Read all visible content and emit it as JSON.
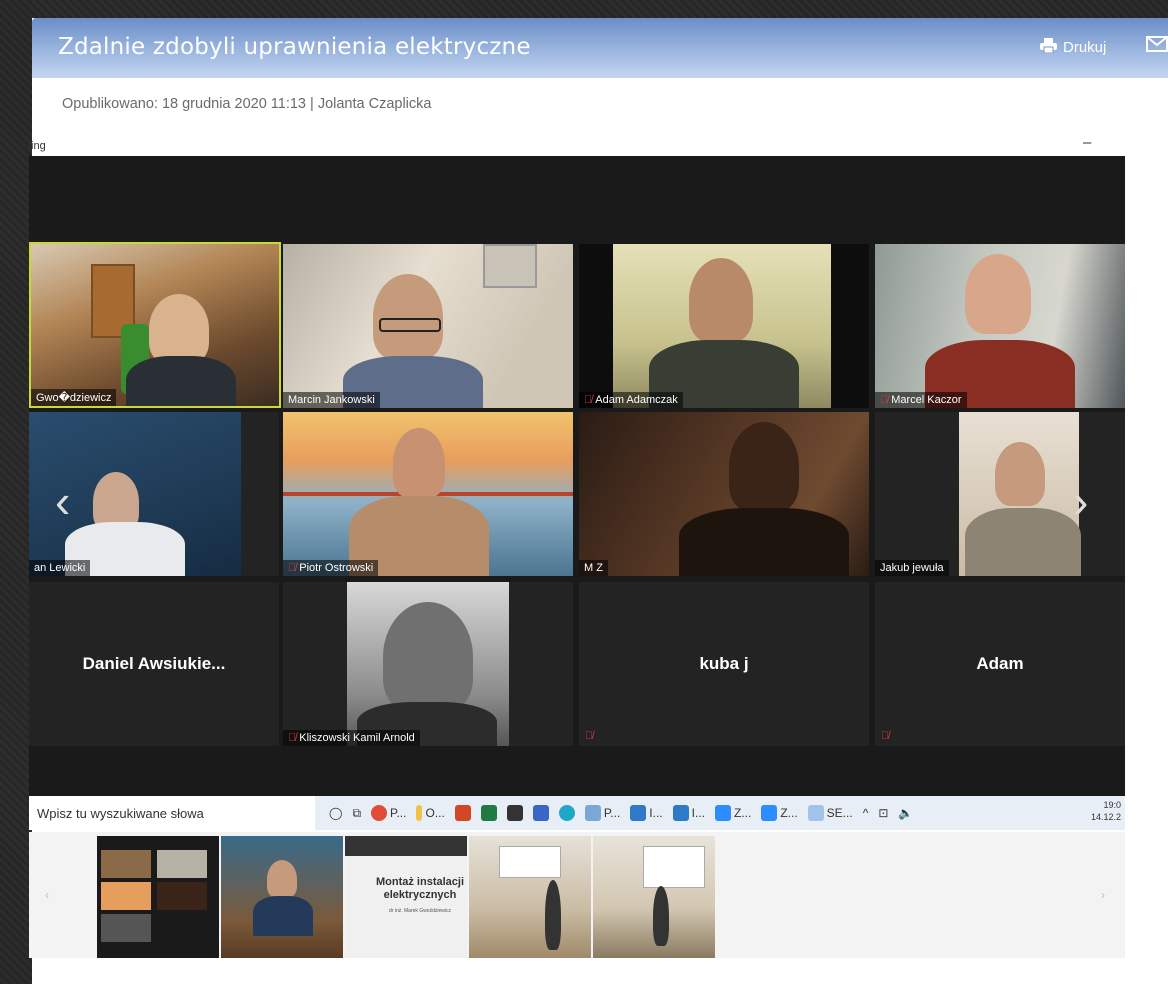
{
  "article": {
    "title": "Zdalnie zdobyli uprawnienia elektryczne",
    "print_label": "Drukuj",
    "published": "Opublikowano: 18 grudnia 2020 11:13 | Jolanta Czaplicka"
  },
  "zoom_window": {
    "app_label": "ting",
    "minimize": "–",
    "participants": [
      {
        "name": "Gwo�dziewicz",
        "muted": false
      },
      {
        "name": "Marcin Jankowski",
        "muted": false
      },
      {
        "name": "Adam Adamczak",
        "muted": true
      },
      {
        "name": "Marcel Kaczor",
        "muted": true
      },
      {
        "name": "an Lewicki",
        "muted": false
      },
      {
        "name": "Piotr Ostrowski",
        "muted": true
      },
      {
        "name": "M Z",
        "muted": false
      },
      {
        "name": "Jakub jewuła",
        "muted": false
      },
      {
        "name": "Daniel  Awsiukie...",
        "muted": false
      },
      {
        "name": "Kliszowski Kamil Arnold",
        "muted": true
      },
      {
        "name": "kuba j",
        "muted": true
      },
      {
        "name": "Adam",
        "muted": true
      }
    ]
  },
  "taskbar": {
    "search_placeholder": "Wpisz tu wyszukiwane słowa",
    "items": [
      "P...",
      "O...",
      "P...",
      "I...",
      "I...",
      "Z...",
      "Z...",
      "SE..."
    ],
    "time": "19:0",
    "date": "14.12.2"
  },
  "gallery": {
    "thumb2_text": "Montaż instalacji elektrycznych",
    "thumb2_sub": "dr inż. Marek Gwoździewicz"
  },
  "colors": {
    "header_top": "#6b8ec7",
    "mute_red": "#e03a3a"
  }
}
